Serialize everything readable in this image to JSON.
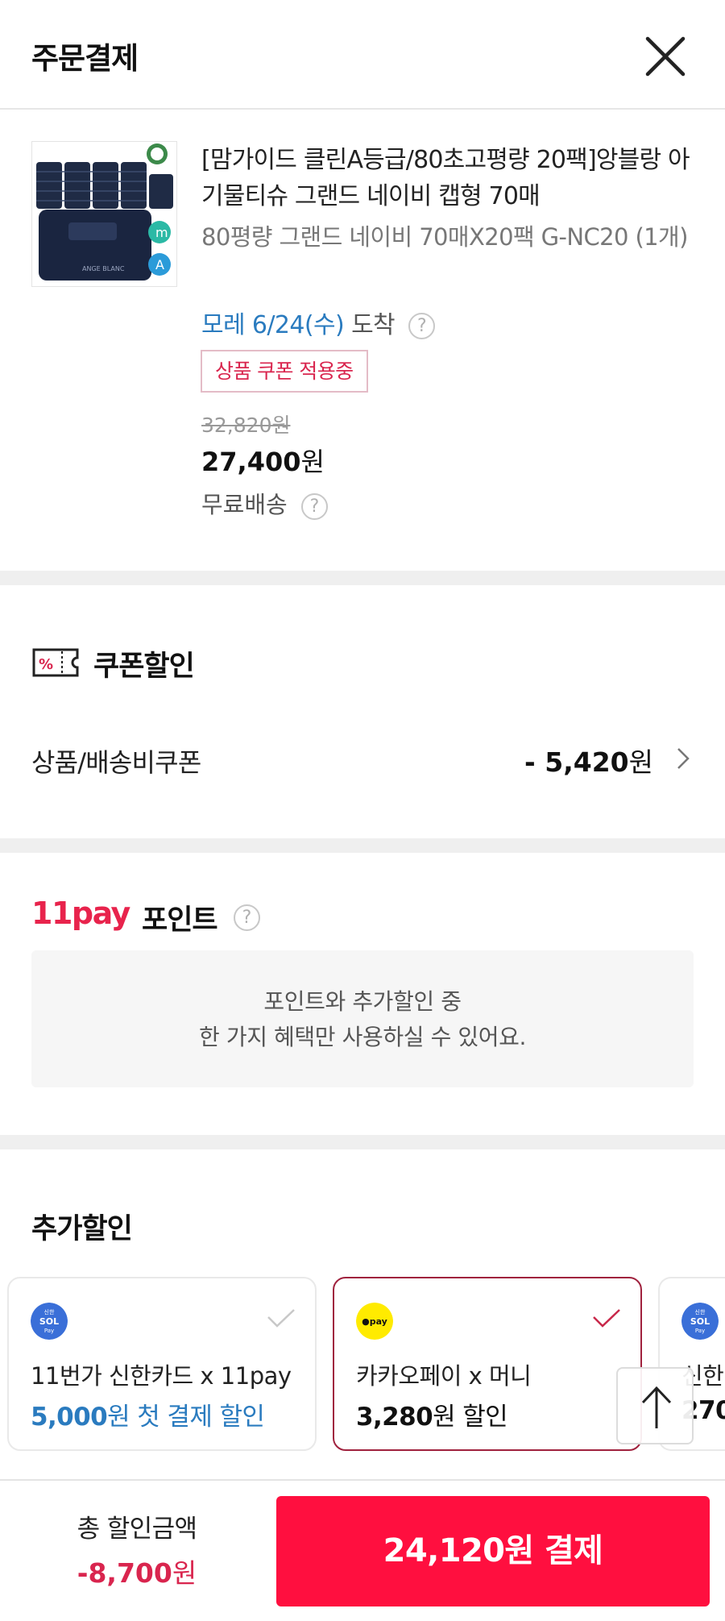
{
  "header": {
    "title": "주문결제"
  },
  "product": {
    "name": "[맘가이드 클린A등급/80초고평량 20팩]앙블랑 아기물티슈 그랜드 네이비 캡형 70매",
    "option": "80평량 그랜드 네이비 70매X20팩 G-NC20 (1개)",
    "arrival_date": "모레 6/24(수)",
    "arrival_suffix": "도착",
    "coupon_badge": "상품 쿠폰 적용중",
    "original_price": "32,820원",
    "sale_price_number": "27,400",
    "sale_price_unit": "원",
    "shipping": "무료배송",
    "help_glyph": "?"
  },
  "coupon_section": {
    "title": "쿠폰할인",
    "row_label": "상품/배송비쿠폰",
    "row_value_number": "- 5,420",
    "row_value_unit": "원"
  },
  "point_section": {
    "brand": "11pay",
    "title": "포인트",
    "notice_line1": "포인트와 추가할인 중",
    "notice_line2": "한 가지 혜택만 사용하실 수 있어요."
  },
  "extra_section": {
    "title": "추가할인",
    "cards": [
      {
        "name": "11번가 신한카드 x 11pay",
        "amount": "5,000",
        "amount_unit": "원",
        "benefit_rest": " 첫 결제 할인",
        "logo": "sol-pay",
        "selected": false
      },
      {
        "name": "카카오페이 x 머니",
        "amount": "3,280",
        "amount_unit": "원",
        "benefit_rest": " 할인",
        "logo": "kakao-pay",
        "selected": true
      },
      {
        "name": "신한",
        "amount": "270",
        "amount_unit": "",
        "benefit_rest": "",
        "logo": "sol-pay",
        "selected": false
      }
    ]
  },
  "logos": {
    "sol_top": "신한",
    "sol_mid": "SOL",
    "sol_bot": "Pay",
    "kakao": "●pay"
  },
  "bottom": {
    "total_label": "총 할인금액",
    "total_value_number": "-8,700",
    "total_value_unit": "원",
    "pay_button": "24,120원 결제"
  },
  "colors": {
    "accent": "#ff0f3f",
    "red_text": "#d9254e",
    "blue": "#2a7bbf",
    "selected_border": "#a0223e",
    "kakao": "#ffeb00"
  }
}
